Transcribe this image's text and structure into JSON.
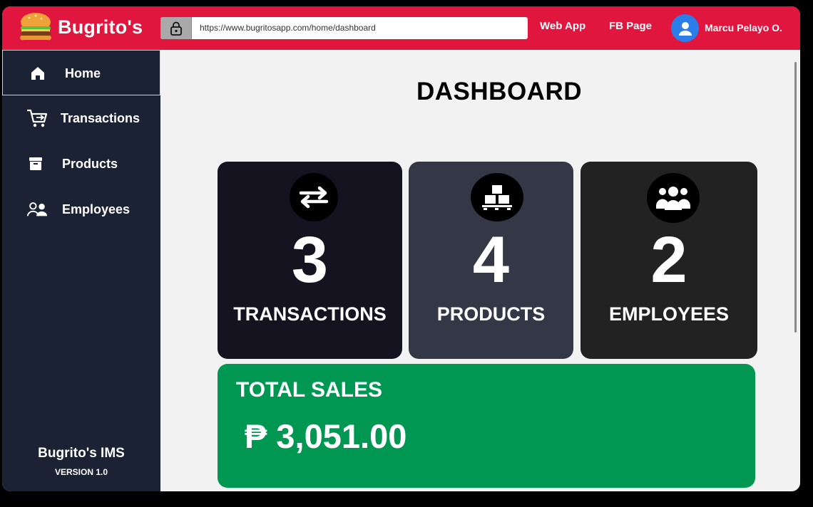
{
  "header": {
    "app_name": "Bugrito's",
    "url": "https://www.bugritosapp.com/home/dashboard",
    "links": [
      "Web App",
      "FB Page"
    ],
    "user_name": "Marcu Pelayo O."
  },
  "sidebar": {
    "items": [
      {
        "label": "Home",
        "icon": "home-icon",
        "active": true
      },
      {
        "label": "Transactions",
        "icon": "cart-icon"
      },
      {
        "label": "Products",
        "icon": "archive-box-icon"
      },
      {
        "label": "Employees",
        "icon": "users-icon"
      }
    ],
    "footer_title": "Bugrito's IMS",
    "footer_version": "VERSION 1.0"
  },
  "main": {
    "title": "DASHBOARD",
    "cards": [
      {
        "value": "3",
        "label": "TRANSACTIONS",
        "icon": "swap-arrows-icon",
        "color": "#15131f"
      },
      {
        "value": "4",
        "label": "PRODUCTS",
        "icon": "boxes-pallet-icon",
        "color": "#343746"
      },
      {
        "value": "2",
        "label": "EMPLOYEES",
        "icon": "group-icon",
        "color": "#222222"
      }
    ],
    "total_sales": {
      "label": "TOTAL SALES",
      "amount": "₱ 3,051.00",
      "color": "#009752"
    }
  },
  "colors": {
    "header": "#e0163f",
    "sidebar": "#1a2233",
    "background": "#f2f2f2"
  }
}
